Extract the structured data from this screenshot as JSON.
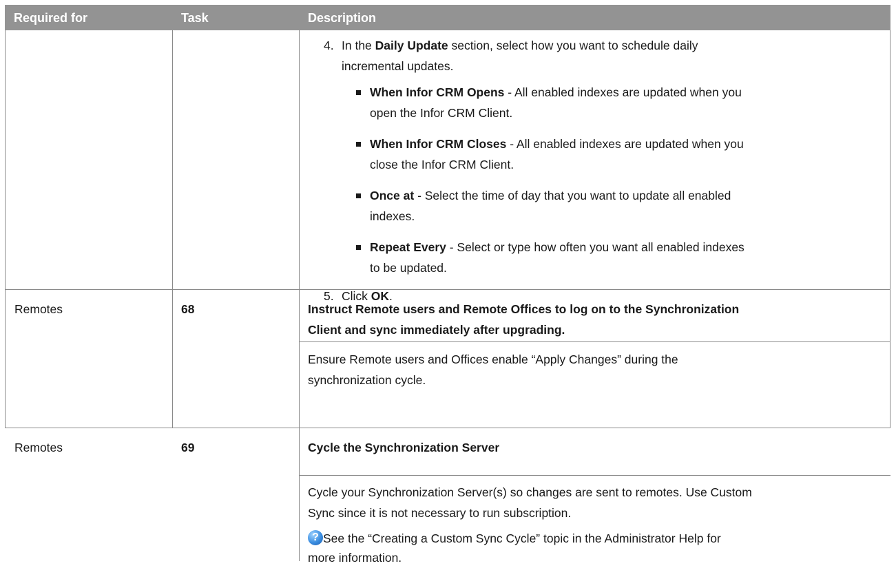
{
  "header": {
    "col1": "Required for",
    "col2": "Task",
    "col3": "Description"
  },
  "row0": {
    "step4_num": "4.",
    "step4_pre": "In the ",
    "step4_bold": "Daily Update",
    "step4_post": " section, select how you want to schedule daily",
    "step4_line2": "incremental updates.",
    "bullets": [
      {
        "term": "When Infor CRM Opens",
        "rest": " - All enabled indexes are updated when you",
        "line2": "open the Infor CRM Client."
      },
      {
        "term": "When Infor CRM Closes",
        "rest": " - All enabled indexes are updated when you",
        "line2": "close the Infor CRM Client."
      },
      {
        "term": "Once at",
        "rest": " - Select the time of day that you want to update all enabled",
        "line2": "indexes."
      },
      {
        "term": "Repeat Every",
        "rest": " - Select or type how often you want all enabled indexes",
        "line2": "to be updated."
      }
    ],
    "step5_num": "5.",
    "step5_pre": "Click ",
    "step5_bold": "OK",
    "step5_post": "."
  },
  "row1": {
    "required_for": "Remotes",
    "task": "68",
    "title_line1": "Instruct Remote users and Remote Offices to log on to the Synchronization",
    "title_line2": "Client and sync immediately after upgrading.",
    "body_line1": "Ensure Remote users and Offices enable “Apply Changes” during the",
    "body_line2": "synchronization cycle."
  },
  "row2": {
    "required_for": "Remotes",
    "task": "69",
    "title": "Cycle the Synchronization Server",
    "body_line1": "Cycle your Synchronization Server(s) so changes are sent to remotes. Use Custom",
    "body_line2": "Sync since it is not necessary to run subscription.",
    "help_icon": "help-circle-icon",
    "help_line1": " See the “Creating a Custom Sync Cycle” topic in the Administrator Help for",
    "help_line2": "more information."
  }
}
